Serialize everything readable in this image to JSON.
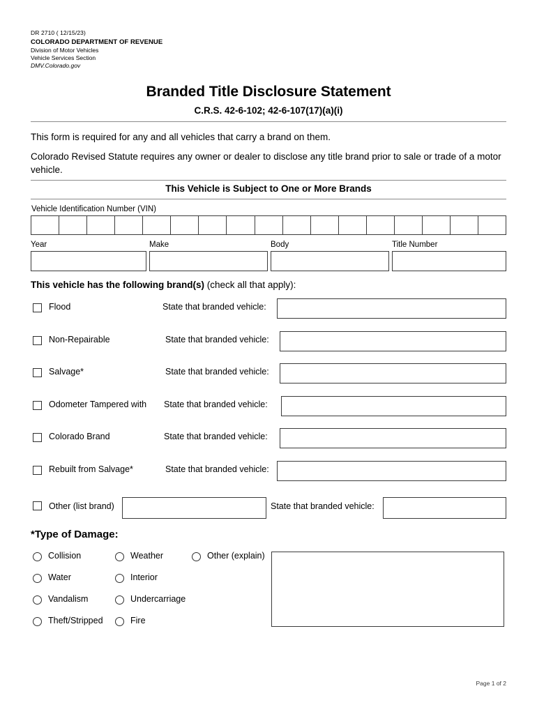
{
  "letterhead": {
    "form_number": "DR 2710 ( 12/15/23)",
    "department": "COLORADO DEPARTMENT OF REVENUE",
    "division": "Division of Motor Vehicles",
    "section": "Vehicle Services Section",
    "website": "DMV.Colorado.gov"
  },
  "title": "Branded Title Disclosure Statement",
  "subtitle": "C.R.S. 42-6-102; 42-6-107(17)(a)(i)",
  "intro": {
    "paragraph_1": "This form is required for any and all vehicles that carry a brand on them.",
    "paragraph_2": "Colorado Revised Statute requires any owner or dealer to disclose any title brand prior to sale or trade of a motor vehicle."
  },
  "subject_heading": "This Vehicle is Subject to One or More Brands",
  "vehicle": {
    "vin_label": "Vehicle Identification Number (VIN)",
    "vin_cell_count": 17,
    "vin_value": "",
    "fields": [
      {
        "label": "Year",
        "value": ""
      },
      {
        "label": "Make",
        "value": ""
      },
      {
        "label": "Body",
        "value": ""
      },
      {
        "label": "Title Number",
        "value": ""
      }
    ]
  },
  "brands": {
    "heading_bold": "This vehicle has the following brand(s)",
    "heading_rest": " (check all that apply):",
    "state_caption": "State that branded vehicle:",
    "items": [
      {
        "label": "Flood",
        "checked": false,
        "state_value": ""
      },
      {
        "label": "Non-Repairable",
        "checked": false,
        "state_value": ""
      },
      {
        "label": "Salvage*",
        "checked": false,
        "state_value": ""
      },
      {
        "label": "Odometer Tampered with",
        "checked": false,
        "state_value": ""
      },
      {
        "label": "Colorado Brand",
        "checked": false,
        "state_value": ""
      },
      {
        "label": "Rebuilt from Salvage*",
        "checked": false,
        "state_value": ""
      }
    ],
    "other": {
      "label": "Other (list brand)",
      "checked": false,
      "brand_value": "",
      "state_caption": "State that branded vehicle:",
      "state_value": ""
    }
  },
  "damage": {
    "heading": "*Type of Damage:",
    "column_1": [
      {
        "label": "Collision",
        "selected": false
      },
      {
        "label": "Water",
        "selected": false
      },
      {
        "label": "Vandalism",
        "selected": false
      },
      {
        "label": "Theft/Stripped",
        "selected": false
      }
    ],
    "column_2": [
      {
        "label": "Weather",
        "selected": false
      },
      {
        "label": "Interior",
        "selected": false
      },
      {
        "label": "Undercarriage",
        "selected": false
      },
      {
        "label": "Fire",
        "selected": false
      }
    ],
    "column_3": [
      {
        "label": "Other (explain)",
        "selected": false
      }
    ],
    "explain_value": ""
  },
  "footer": {
    "page_text": "Page 1 of 2"
  }
}
